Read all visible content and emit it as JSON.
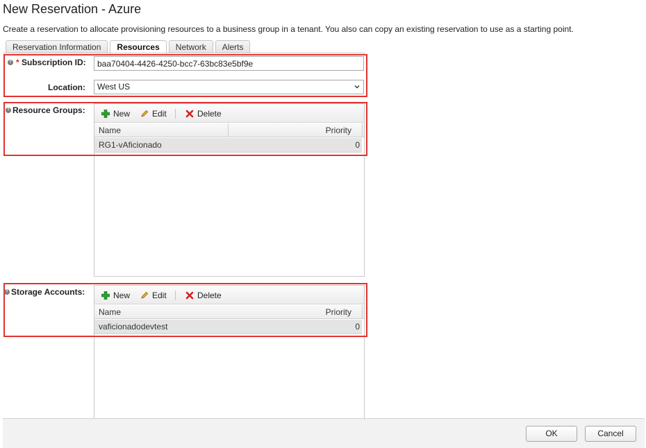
{
  "header": {
    "title": "New Reservation - Azure",
    "description": "Create a reservation to allocate provisioning resources to a business group in a tenant. You also can copy an existing reservation to use as a starting point."
  },
  "tabs": [
    {
      "label": "Reservation Information",
      "active": false
    },
    {
      "label": "Resources",
      "active": true
    },
    {
      "label": "Network",
      "active": false
    },
    {
      "label": "Alerts",
      "active": false
    }
  ],
  "subscription": {
    "label": "Subscription ID:",
    "required_mark": "*",
    "value": "baa70404-4426-4250-bcc7-63bc83e5bf9e"
  },
  "location": {
    "label": "Location:",
    "selected": "West US"
  },
  "resource_groups": {
    "label": "Resource Groups:",
    "toolbar": {
      "new": "New",
      "edit": "Edit",
      "delete": "Delete"
    },
    "columns": {
      "name": "Name",
      "priority": "Priority"
    },
    "rows": [
      {
        "name": "RG1-vAficionado",
        "priority": "0"
      }
    ]
  },
  "storage_accounts": {
    "label": "Storage Accounts:",
    "toolbar": {
      "new": "New",
      "edit": "Edit",
      "delete": "Delete"
    },
    "columns": {
      "name": "Name",
      "priority": "Priority"
    },
    "rows": [
      {
        "name": "vaficionadodevtest",
        "priority": "0"
      }
    ]
  },
  "footer": {
    "ok": "OK",
    "cancel": "Cancel"
  },
  "colors": {
    "highlight": "#e0332f",
    "add": "#2e9e2e",
    "delete": "#d62020"
  }
}
